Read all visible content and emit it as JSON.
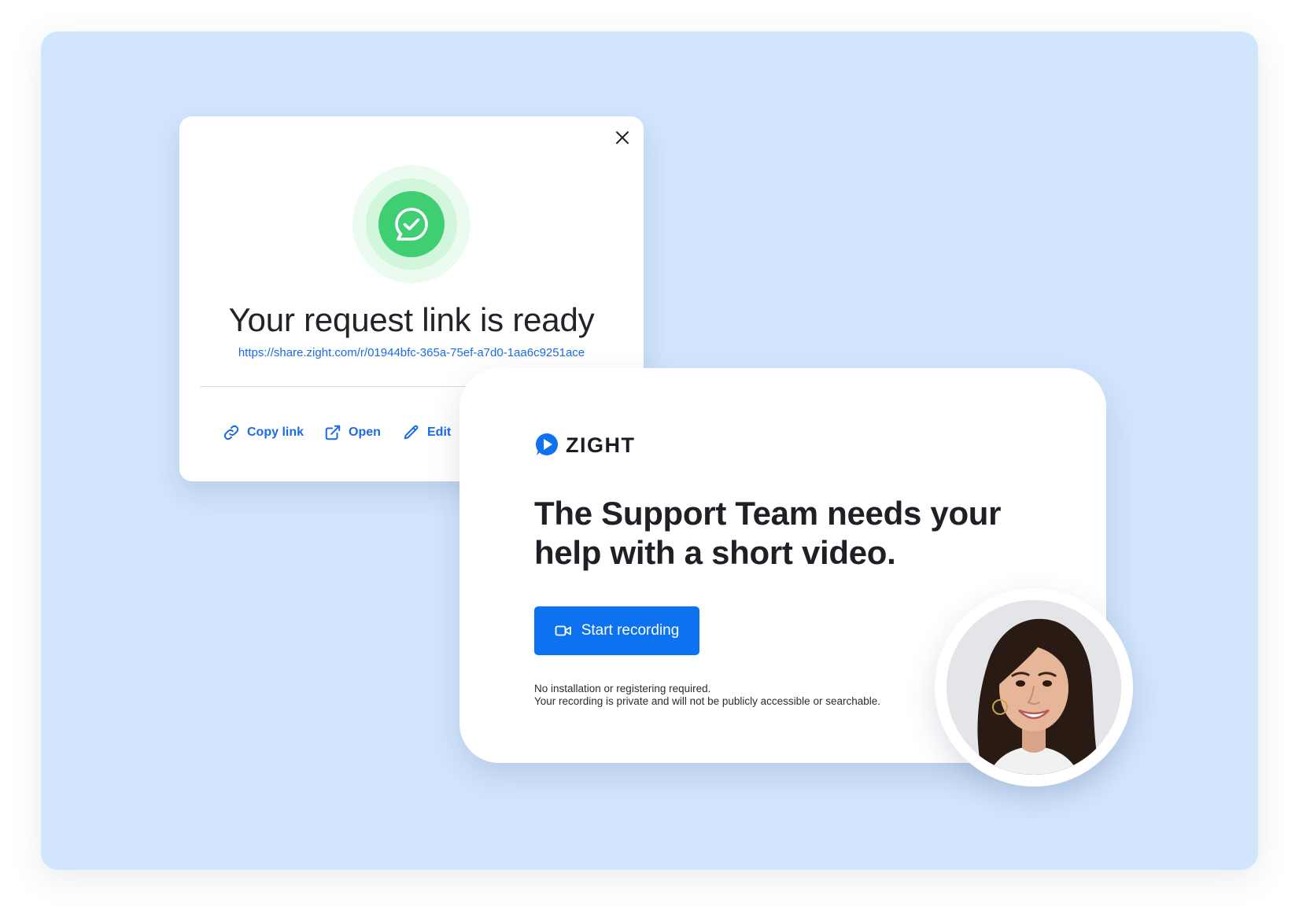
{
  "link_card": {
    "title": "Your request link is ready",
    "url": "https://share.zight.com/r/01944bfc-365a-75ef-a7d0-1aa6c9251ace",
    "actions": {
      "copy_label": "Copy link",
      "open_label": "Open",
      "edit_label": "Edit"
    },
    "icons": {
      "close": "close-icon",
      "success": "chat-check-icon",
      "copy": "link-icon",
      "open": "external-link-icon",
      "edit": "pencil-icon"
    }
  },
  "request_card": {
    "brand": "ZIGHT",
    "headline_line1": "The Support Team needs your",
    "headline_line2": "help with a short video.",
    "button_label": "Start recording",
    "note_line1": "No installation or registering required.",
    "note_line2": "Your recording is private and will not be publicly accessible or searchable.",
    "icons": {
      "brand": "zight-logo-icon",
      "button": "video-camera-icon"
    }
  },
  "colors": {
    "background": "#d1e5fd",
    "accent": "#0d72f0",
    "link": "#1b6ae6",
    "success": "#3fcf72",
    "text": "#1e2026"
  }
}
